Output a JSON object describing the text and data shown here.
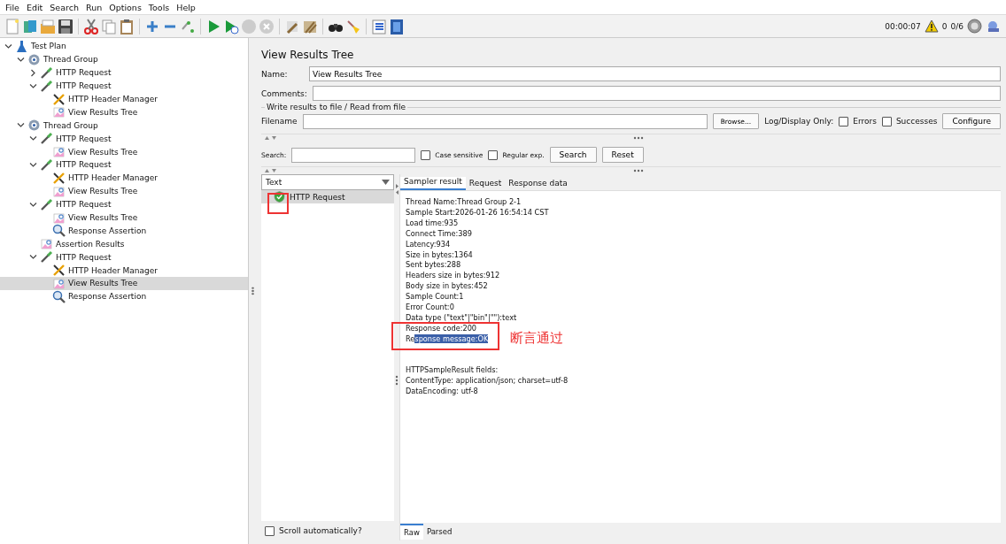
{
  "menu": [
    "File",
    "Edit",
    "Search",
    "Run",
    "Options",
    "Tools",
    "Help"
  ],
  "status": {
    "elapsed": "00:00:07",
    "warnings": "0",
    "threads": "0/6"
  },
  "tree": [
    {
      "label": "Test Plan",
      "kind": "plan",
      "expanded": true,
      "selected": false,
      "children": [
        {
          "label": "Thread Group",
          "kind": "group",
          "expanded": true,
          "selected": false,
          "children": [
            {
              "label": "HTTP Request",
              "kind": "sampler",
              "expanded": false,
              "selected": false
            },
            {
              "label": "HTTP Request",
              "kind": "sampler",
              "expanded": true,
              "selected": false,
              "children": [
                {
                  "label": "HTTP Header Manager",
                  "kind": "config",
                  "selected": false
                },
                {
                  "label": "View Results Tree",
                  "kind": "listener",
                  "selected": false
                }
              ]
            }
          ]
        },
        {
          "label": "Thread Group",
          "kind": "group",
          "expanded": true,
          "selected": false,
          "children": [
            {
              "label": "HTTP Request",
              "kind": "sampler",
              "expanded": true,
              "selected": false,
              "children": [
                {
                  "label": "View Results Tree",
                  "kind": "listener",
                  "selected": false
                }
              ]
            },
            {
              "label": "HTTP Request",
              "kind": "sampler",
              "expanded": true,
              "selected": false,
              "children": [
                {
                  "label": "HTTP Header Manager",
                  "kind": "config",
                  "selected": false
                },
                {
                  "label": "View Results Tree",
                  "kind": "listener",
                  "selected": false
                }
              ]
            },
            {
              "label": "HTTP Request",
              "kind": "sampler",
              "expanded": true,
              "selected": false,
              "children": [
                {
                  "label": "View Results Tree",
                  "kind": "listener",
                  "selected": false
                },
                {
                  "label": "Response Assertion",
                  "kind": "assertion",
                  "selected": false
                }
              ]
            },
            {
              "label": "Assertion Results",
              "kind": "listener",
              "selected": false
            },
            {
              "label": "HTTP Request",
              "kind": "sampler",
              "expanded": true,
              "selected": false,
              "children": [
                {
                  "label": "HTTP Header Manager",
                  "kind": "config",
                  "selected": false
                },
                {
                  "label": "View Results Tree",
                  "kind": "listener",
                  "selected": true
                },
                {
                  "label": "Response Assertion",
                  "kind": "assertion",
                  "selected": false
                }
              ]
            }
          ]
        }
      ]
    }
  ],
  "panel": {
    "title": "View Results Tree",
    "name_label": "Name:",
    "name_value": "View Results Tree",
    "comments_label": "Comments:",
    "file_group": "Write results to file / Read from file",
    "filename_label": "Filename",
    "browse": "Browse...",
    "log_label": "Log/Display Only:",
    "errors": {
      "label": "Errors",
      "checked": false
    },
    "successes": {
      "label": "Successes",
      "checked": false
    },
    "configure": "Configure",
    "search_label": "Search:",
    "case_sensitive": {
      "label": "Case sensitive",
      "checked": false
    },
    "regex": {
      "label": "Regular exp.",
      "checked": false
    },
    "search_button": "Search",
    "reset_button": "Reset"
  },
  "results": {
    "renderer": "Text",
    "samples": [
      {
        "label": "HTTP Request",
        "passed": true,
        "selected": true
      }
    ],
    "scroll_auto": {
      "label": "Scroll automatically?",
      "checked": false
    },
    "tabs": [
      {
        "label": "Sampler result",
        "selected": true
      },
      {
        "label": "Request",
        "selected": false
      },
      {
        "label": "Response data",
        "selected": false
      }
    ],
    "sections": [
      {
        "lines": [
          {
            "text": "Thread Name:Thread Group 2-1"
          },
          {
            "text": "Sample Start:2026-01-26 16:54:14 CST"
          },
          {
            "text": "Load time:935"
          },
          {
            "text": "Connect Time:389"
          },
          {
            "text": "Latency:934"
          },
          {
            "text": "Size in bytes:1364"
          },
          {
            "text": "Sent bytes:288"
          },
          {
            "text": "Headers size in bytes:912"
          },
          {
            "text": "Body size in bytes:452"
          },
          {
            "text": "Sample Count:1"
          },
          {
            "text": "Error Count:0"
          },
          {
            "text": "Data type (\"text\"|\"bin\"|\"\"):text"
          },
          {
            "text": "Response code:200"
          },
          {
            "text": "Re",
            "highlighted": "sponse message:OK"
          }
        ]
      },
      {
        "lines": [
          {
            "text": "HTTPSampleResult fields:"
          },
          {
            "text": "ContentType: application/json; charset=utf-8"
          },
          {
            "text": "DataEncoding: utf-8"
          }
        ]
      }
    ],
    "bottom_tabs": [
      {
        "label": "Raw",
        "selected": true
      },
      {
        "label": "Parsed",
        "selected": false
      }
    ]
  },
  "annotation": {
    "text": "断言通过"
  }
}
